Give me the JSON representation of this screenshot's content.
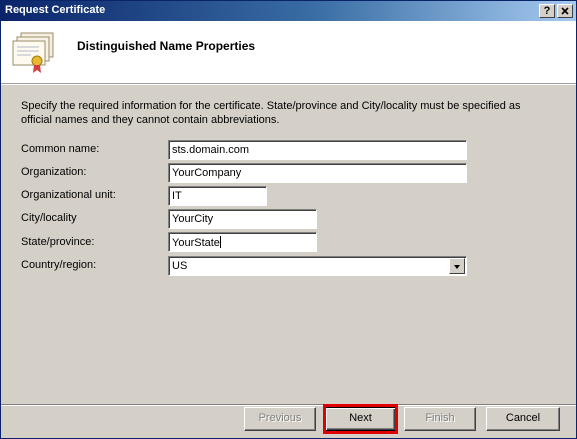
{
  "window": {
    "title": "Request Certificate",
    "help_button": "?",
    "close_button": "X"
  },
  "header": {
    "title": "Distinguished Name Properties",
    "icon": "certificate-icon"
  },
  "description": "Specify the required information for the certificate. State/province and City/locality must be specified as official names and they cannot contain abbreviations.",
  "form": {
    "common_name": {
      "label": "Common name:",
      "value": "sts.domain.com"
    },
    "organization": {
      "label": "Organization:",
      "value": "YourCompany"
    },
    "organizational_unit": {
      "label": "Organizational unit:",
      "value": "IT"
    },
    "city": {
      "label": "City/locality",
      "value": "YourCity"
    },
    "state": {
      "label": "State/province:",
      "value": "YourState"
    },
    "country": {
      "label": "Country/region:",
      "value": "US"
    }
  },
  "buttons": {
    "previous": "Previous",
    "next": "Next",
    "finish": "Finish",
    "cancel": "Cancel"
  },
  "colors": {
    "highlight": "#e00000",
    "titlebar": "#0a246a"
  }
}
